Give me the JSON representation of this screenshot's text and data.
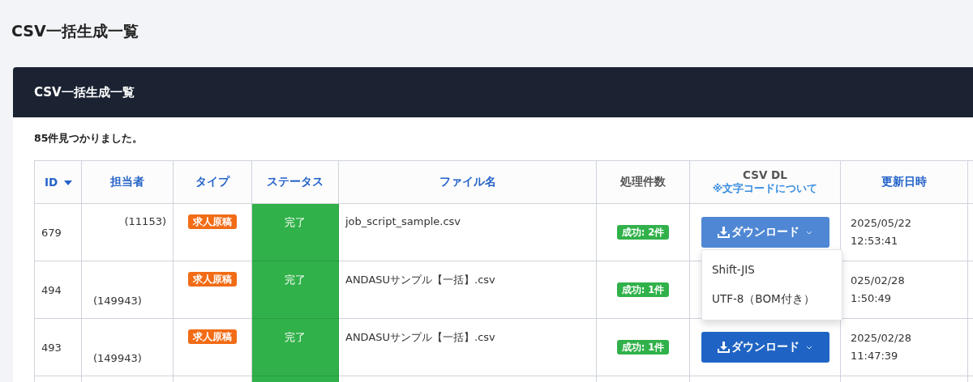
{
  "page_title": "CSV一括生成一覧",
  "card": {
    "title": "CSV一括生成一覧",
    "result_count": "85件見つかりました。"
  },
  "table": {
    "columns": [
      {
        "label": "ID",
        "kind": "sortable",
        "sorted_desc": true
      },
      {
        "label": "担当者",
        "kind": "link"
      },
      {
        "label": "タイプ",
        "kind": "link"
      },
      {
        "label": "ステータス",
        "kind": "link"
      },
      {
        "label": "ファイル名",
        "kind": "link"
      },
      {
        "label": "処理件数",
        "kind": "plain"
      },
      {
        "label": "CSV DL",
        "kind": "csv",
        "note": "※文字コードについて"
      },
      {
        "label": "更新日時",
        "kind": "link"
      }
    ],
    "rows": [
      {
        "id": "679",
        "staff": "(11153)",
        "type": "求人原稿",
        "status": "完了",
        "file": "job_script_sample.csv",
        "count": "成功: 2件",
        "download": {
          "label": "ダウンロード",
          "visible": true,
          "open": true,
          "menu": [
            "Shift-JIS",
            "UTF-8（BOM付き）"
          ]
        },
        "updated": [
          "2025/05/22",
          "12:53:41"
        ]
      },
      {
        "id": "494",
        "staff": "(149943)",
        "type": "求人原稿",
        "status": "完了",
        "file": "ANDASUサンプル【一括】.csv",
        "count": "成功: 1件",
        "download": {
          "visible": false
        },
        "updated": [
          "025/02/28",
          "1:50:49"
        ]
      },
      {
        "id": "493",
        "staff": "(149943)",
        "type": "求人原稿",
        "status": "完了",
        "file": "ANDASUサンプル【一括】.csv",
        "count": "成功: 1件",
        "download": {
          "label": "ダウンロード",
          "visible": true,
          "open": false
        },
        "updated": [
          "2025/02/28",
          "11:47:39"
        ]
      }
    ]
  }
}
